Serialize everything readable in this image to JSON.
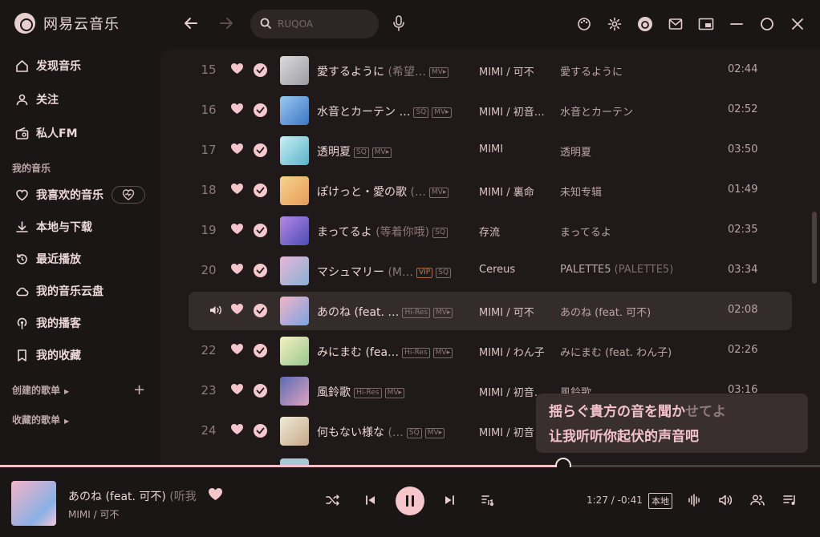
{
  "app": {
    "name": "网易云音乐"
  },
  "search": {
    "placeholder": "RUQOA"
  },
  "sidebar": {
    "items": [
      {
        "label": "发现音乐",
        "icon": "home-icon"
      },
      {
        "label": "关注",
        "icon": "user-icon"
      },
      {
        "label": "私人FM",
        "icon": "radio-icon"
      }
    ],
    "my_music_heading": "我的音乐",
    "my_items": [
      {
        "label": "我喜欢的音乐",
        "icon": "heart-icon"
      },
      {
        "label": "本地与下载",
        "icon": "download-icon"
      },
      {
        "label": "最近播放",
        "icon": "history-icon"
      },
      {
        "label": "我的音乐云盘",
        "icon": "cloud-icon"
      },
      {
        "label": "我的播客",
        "icon": "podcast-icon"
      },
      {
        "label": "我的收藏",
        "icon": "bookmark-icon"
      }
    ],
    "created_playlists": "创建的歌单",
    "collected_playlists": "收藏的歌单"
  },
  "songs": [
    {
      "num": "15",
      "title": "愛するように",
      "alias": "(希望…",
      "tags": [
        "MV"
      ],
      "artist": "MIMI / 可不",
      "album": "愛するように",
      "album_alias": "",
      "duration": "02:44",
      "cover": [
        "#dcdcdc",
        "#9a9aa4"
      ]
    },
    {
      "num": "16",
      "title": "水音とカーテン …",
      "alias": "",
      "tags": [
        "SQ",
        "MV"
      ],
      "artist": "MIMI / 初音…",
      "album": "水音とカーテン",
      "album_alias": "",
      "duration": "02:52",
      "cover": [
        "#9cc8f2",
        "#3a76c4"
      ]
    },
    {
      "num": "17",
      "title": "透明夏",
      "alias": "",
      "tags": [
        "SQ",
        "MV"
      ],
      "artist": "MIMI",
      "album": "透明夏",
      "album_alias": "",
      "duration": "03:50",
      "cover": [
        "#c8f0f4",
        "#5ab2c8"
      ]
    },
    {
      "num": "18",
      "title": "ぽけっと・愛の歌",
      "alias": "(…",
      "tags": [
        "MV"
      ],
      "artist": "MIMI / 裏命",
      "album": "未知专辑",
      "album_alias": "",
      "duration": "01:49",
      "cover": [
        "#f6d48a",
        "#e59a5a"
      ]
    },
    {
      "num": "19",
      "title": "まってるよ",
      "alias": "(等着你哦)",
      "tags": [
        "SQ"
      ],
      "artist": "存流",
      "album": "まってるよ",
      "album_alias": "",
      "duration": "02:35",
      "cover": [
        "#b488e6",
        "#4e4cb4"
      ]
    },
    {
      "num": "20",
      "title": "マシュマリー",
      "alias": "(M…",
      "tags": [
        "VIP",
        "SQ"
      ],
      "artist": "Cereus",
      "album": "PALETTE5",
      "album_alias": "(PALETTE5)",
      "duration": "03:34",
      "cover": [
        "#e6b8d8",
        "#8ab0d4"
      ]
    },
    {
      "num": "21",
      "title": "あのね (feat. …",
      "alias": "",
      "tags": [
        "Hi-Res",
        "MV"
      ],
      "artist": "MIMI / 可不",
      "album": "あのね (feat. 可不)",
      "album_alias": "",
      "duration": "02:08",
      "cover": [
        "#f4b4c8",
        "#7aa4e0"
      ],
      "playing": true
    },
    {
      "num": "22",
      "title": "みにまむ (fea…",
      "alias": "",
      "tags": [
        "Hi-Res",
        "MV"
      ],
      "artist": "MIMI / わん子",
      "album": "みにまむ (feat. わん子)",
      "album_alias": "",
      "duration": "02:26",
      "cover": [
        "#f6f0c0",
        "#98c890"
      ]
    },
    {
      "num": "23",
      "title": "風鈴歌",
      "alias": "",
      "tags": [
        "Hi-Res",
        "MV"
      ],
      "artist": "MIMI / 初音…",
      "album": "風鈴歌",
      "album_alias": "",
      "duration": "03:16",
      "cover": [
        "#5a6ab4",
        "#e0a4c0"
      ]
    },
    {
      "num": "24",
      "title": "何もない様な",
      "alias": "(…",
      "tags": [
        "SQ",
        "MV"
      ],
      "artist": "MIMI / 初音",
      "album": "",
      "album_alias": "",
      "duration": "",
      "cover": [
        "#f0ead8",
        "#c8a888"
      ]
    }
  ],
  "lyric": {
    "line1_sung": "揺らぐ貴方の音を聞か",
    "line1_rest": "せてよ",
    "line2": "让我听听你起伏的声音吧"
  },
  "player": {
    "title": "あのね (feat. 可不)",
    "alias": "(听我",
    "artist": "MIMI / 可不",
    "time": "1:27 / -0:41",
    "source_badge": "本地",
    "progress": 0.687
  },
  "colors": {
    "accent": "#f4c6cb",
    "background": "#1b1616",
    "panel": "#1f1919"
  }
}
